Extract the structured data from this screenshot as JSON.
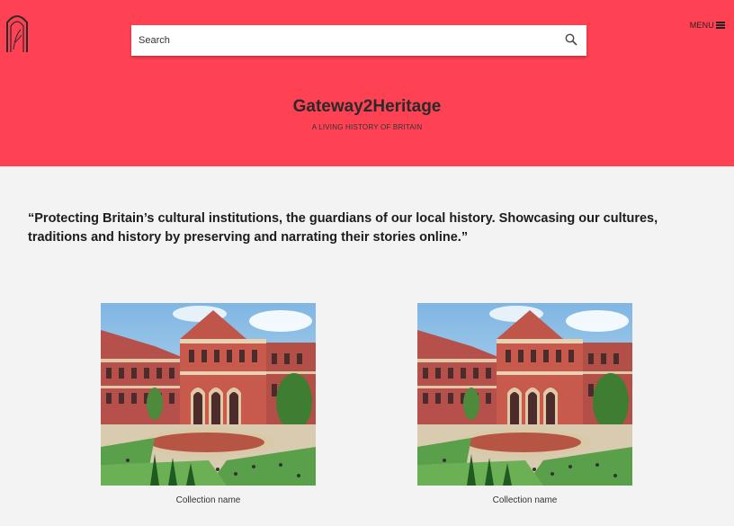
{
  "header": {
    "search": {
      "placeholder": "Search"
    },
    "menu_label": "MENU",
    "brand_title": "Gateway2Heritage",
    "brand_subtitle": "A LIVING HISTORY OF BRITAIN",
    "accent_color": "#fe4253"
  },
  "main": {
    "quote": "“Protecting Britain’s cultural institutions, the guardians of our local history. Showcasing our cultures, traditions and history by preserving and narrating their stories online.”",
    "collections": [
      {
        "caption": "Collection name",
        "image": "museum-courtyard-photo"
      },
      {
        "caption": "Collection name",
        "image": "museum-courtyard-photo"
      }
    ]
  }
}
